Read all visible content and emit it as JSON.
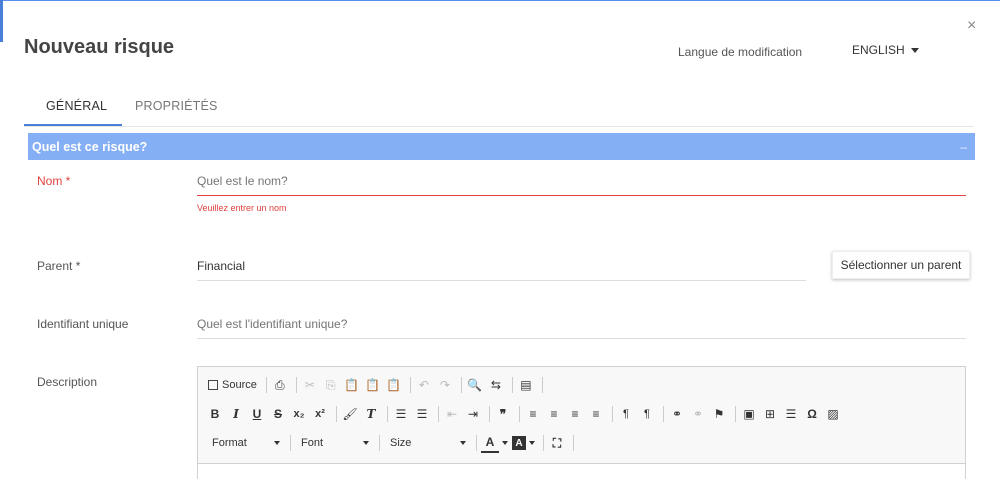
{
  "header": {
    "title": "Nouveau risque",
    "language_label": "Langue de modification",
    "language_value": "ENGLISH",
    "close_glyph": "×"
  },
  "tabs": [
    {
      "label": "GÉNÉRAL",
      "active": true
    },
    {
      "label": "PROPRIÉTÉS",
      "active": false
    }
  ],
  "section": {
    "title": "Quel est ce risque?",
    "collapse_glyph": "–"
  },
  "fields": {
    "name": {
      "label": "Nom *",
      "placeholder": "Quel est le nom?",
      "value": "",
      "error": "Veuillez entrer un nom"
    },
    "parent": {
      "label": "Parent  *",
      "value": "Financial",
      "button": "Sélectionner un parent"
    },
    "uid": {
      "label": "Identifiant unique",
      "placeholder": "Quel est l'identifiant unique?",
      "value": ""
    },
    "description": {
      "label": "Description"
    }
  },
  "editor": {
    "source_label": "Source",
    "format_label": "Format",
    "font_label": "Font",
    "size_label": "Size",
    "icons_row1": [
      "source-icon",
      "print-icon",
      "cut-icon",
      "copy-icon",
      "paste-icon",
      "paste-text-icon",
      "paste-word-icon",
      "undo-icon",
      "redo-icon",
      "find-icon",
      "replace-icon",
      "spellcheck-icon"
    ],
    "icons_row2": [
      "bold-icon",
      "italic-icon",
      "underline-icon",
      "strike-icon",
      "subscript-icon",
      "superscript-icon",
      "copy-format-icon",
      "remove-format-icon",
      "numbered-list-icon",
      "bulleted-list-icon",
      "outdent-icon",
      "indent-icon",
      "blockquote-icon",
      "align-left-icon",
      "align-center-icon",
      "align-right-icon",
      "justify-icon",
      "ltr-icon",
      "rtl-icon",
      "link-icon",
      "unlink-icon",
      "anchor-icon",
      "flash-icon",
      "table-icon",
      "horizontal-line-icon",
      "special-char-icon",
      "image-icon"
    ],
    "icons_row3": [
      "text-color-icon",
      "bg-color-icon",
      "maximize-icon"
    ]
  },
  "colors": {
    "accent": "#4a7fd9",
    "section_bg": "#85aff5",
    "error": "#e0423f"
  }
}
